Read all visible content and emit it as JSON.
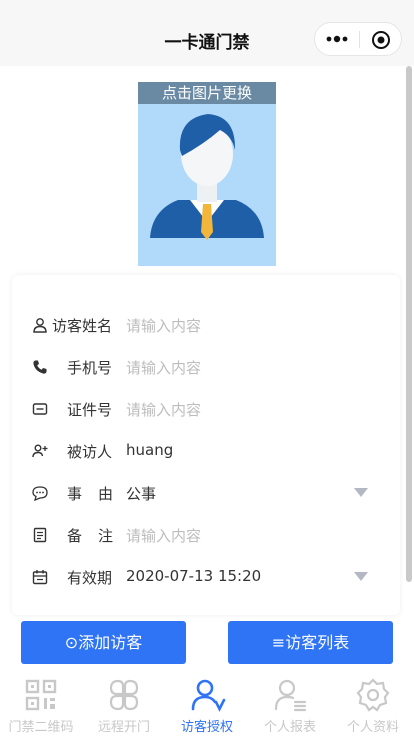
{
  "header": {
    "title": "一卡通门禁"
  },
  "photo": {
    "banner": "点击图片更换"
  },
  "form": {
    "fields": [
      {
        "label": "访客姓名",
        "value": "",
        "placeholder": "请输入内容",
        "icon": "user-icon"
      },
      {
        "label": "手机号",
        "value": "",
        "placeholder": "请输入内容",
        "icon": "phone-icon"
      },
      {
        "label": "证件号",
        "value": "",
        "placeholder": "请输入内容",
        "icon": "id-card-icon"
      },
      {
        "label": "被访人",
        "value": "huang",
        "placeholder": "",
        "icon": "user-plus-icon"
      },
      {
        "label": "事由",
        "value": "公事",
        "placeholder": "",
        "icon": "message-icon"
      },
      {
        "label": "备注",
        "value": "",
        "placeholder": "请输入内容",
        "icon": "note-icon"
      },
      {
        "label": "有效期",
        "value": "2020-07-13 15:20",
        "placeholder": "",
        "icon": "calendar-icon"
      }
    ]
  },
  "buttons": {
    "add": "⊙添加访客",
    "list": "≡访客列表"
  },
  "tabs": [
    {
      "label": "门禁二维码",
      "icon": "qrcode-icon",
      "active": false
    },
    {
      "label": "远程开门",
      "icon": "clover-icon",
      "active": false
    },
    {
      "label": "访客授权",
      "icon": "visitor-icon",
      "active": true
    },
    {
      "label": "个人报表",
      "icon": "report-icon",
      "active": false
    },
    {
      "label": "个人资料",
      "icon": "settings-icon",
      "active": false
    }
  ],
  "colors": {
    "accent": "#2f74f5",
    "inactive": "#c8c8c8",
    "placeholder": "#bdbdbd"
  }
}
